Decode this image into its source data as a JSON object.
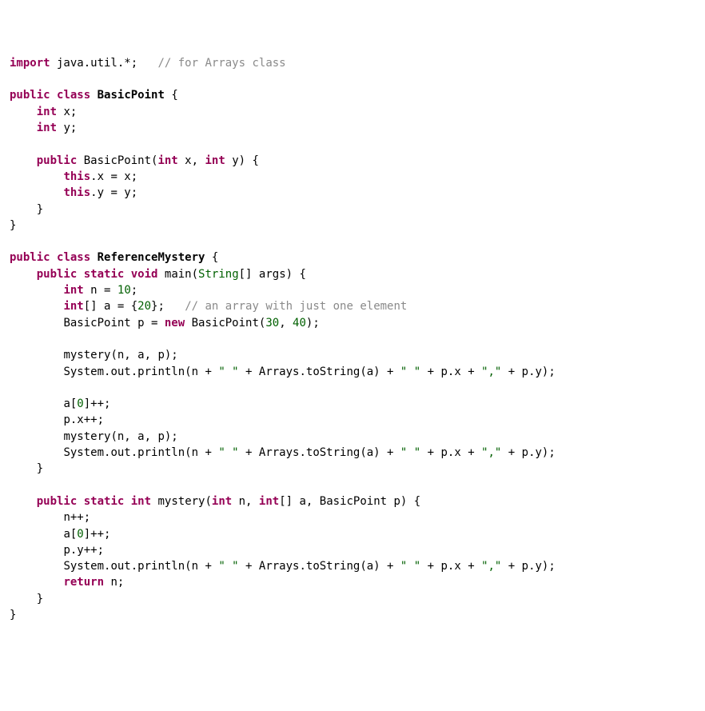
{
  "lines": [
    {
      "indent": 0,
      "tokens": [
        {
          "t": "import",
          "c": "kw"
        },
        {
          "t": " java.util."
        },
        {
          "t": "*",
          "c": "op"
        },
        {
          "t": ";"
        },
        {
          "t": "   "
        },
        {
          "t": "// for Arrays class",
          "c": "cmt"
        }
      ]
    },
    {
      "indent": 0,
      "tokens": []
    },
    {
      "indent": 0,
      "tokens": [
        {
          "t": "public",
          "c": "kw"
        },
        {
          "t": " "
        },
        {
          "t": "class",
          "c": "kw"
        },
        {
          "t": " "
        },
        {
          "t": "BasicPoint",
          "c": "cls"
        },
        {
          "t": " {"
        }
      ]
    },
    {
      "indent": 1,
      "tokens": [
        {
          "t": "int",
          "c": "kw"
        },
        {
          "t": " x;"
        }
      ]
    },
    {
      "indent": 1,
      "tokens": [
        {
          "t": "int",
          "c": "kw"
        },
        {
          "t": " y;"
        }
      ]
    },
    {
      "indent": 0,
      "tokens": []
    },
    {
      "indent": 1,
      "tokens": [
        {
          "t": "public",
          "c": "kw"
        },
        {
          "t": " BasicPoint("
        },
        {
          "t": "int",
          "c": "kw"
        },
        {
          "t": " x, "
        },
        {
          "t": "int",
          "c": "kw"
        },
        {
          "t": " y) {"
        }
      ]
    },
    {
      "indent": 2,
      "tokens": [
        {
          "t": "this",
          "c": "kw"
        },
        {
          "t": ".x = x;"
        }
      ]
    },
    {
      "indent": 2,
      "tokens": [
        {
          "t": "this",
          "c": "kw"
        },
        {
          "t": ".y = y;"
        }
      ]
    },
    {
      "indent": 1,
      "tokens": [
        {
          "t": "}"
        }
      ]
    },
    {
      "indent": 0,
      "tokens": [
        {
          "t": "}"
        }
      ]
    },
    {
      "indent": 0,
      "tokens": []
    },
    {
      "indent": 0,
      "tokens": [
        {
          "t": "public",
          "c": "kw"
        },
        {
          "t": " "
        },
        {
          "t": "class",
          "c": "kw"
        },
        {
          "t": " "
        },
        {
          "t": "ReferenceMystery",
          "c": "cls"
        },
        {
          "t": " {"
        }
      ]
    },
    {
      "indent": 1,
      "tokens": [
        {
          "t": "public",
          "c": "kw"
        },
        {
          "t": " "
        },
        {
          "t": "static",
          "c": "kw"
        },
        {
          "t": " "
        },
        {
          "t": "void",
          "c": "kw"
        },
        {
          "t": " main("
        },
        {
          "t": "String",
          "c": "typ"
        },
        {
          "t": "[] args) {"
        }
      ]
    },
    {
      "indent": 2,
      "tokens": [
        {
          "t": "int",
          "c": "kw"
        },
        {
          "t": " n = "
        },
        {
          "t": "10",
          "c": "num"
        },
        {
          "t": ";"
        }
      ]
    },
    {
      "indent": 2,
      "tokens": [
        {
          "t": "int",
          "c": "kw"
        },
        {
          "t": "[] a = {"
        },
        {
          "t": "20",
          "c": "num"
        },
        {
          "t": "};   "
        },
        {
          "t": "// an array with just one element",
          "c": "cmt"
        }
      ]
    },
    {
      "indent": 2,
      "tokens": [
        {
          "t": "BasicPoint p = "
        },
        {
          "t": "new",
          "c": "kw"
        },
        {
          "t": " BasicPoint("
        },
        {
          "t": "30",
          "c": "num"
        },
        {
          "t": ", "
        },
        {
          "t": "40",
          "c": "num"
        },
        {
          "t": ");"
        }
      ]
    },
    {
      "indent": 0,
      "tokens": []
    },
    {
      "indent": 2,
      "tokens": [
        {
          "t": "mystery(n, a, p);"
        }
      ]
    },
    {
      "indent": 2,
      "tokens": [
        {
          "t": "System.out.println(n + "
        },
        {
          "t": "\" \"",
          "c": "str"
        },
        {
          "t": " + Arrays.toString(a) + "
        },
        {
          "t": "\" \"",
          "c": "str"
        },
        {
          "t": " + p.x + "
        },
        {
          "t": "\",\"",
          "c": "str"
        },
        {
          "t": " + p.y);"
        }
      ]
    },
    {
      "indent": 0,
      "tokens": []
    },
    {
      "indent": 2,
      "tokens": [
        {
          "t": "a["
        },
        {
          "t": "0",
          "c": "num"
        },
        {
          "t": "]++;"
        }
      ]
    },
    {
      "indent": 2,
      "tokens": [
        {
          "t": "p.x++;"
        }
      ]
    },
    {
      "indent": 2,
      "tokens": [
        {
          "t": "mystery(n, a, p);"
        }
      ]
    },
    {
      "indent": 2,
      "tokens": [
        {
          "t": "System.out.println(n + "
        },
        {
          "t": "\" \"",
          "c": "str"
        },
        {
          "t": " + Arrays.toString(a) + "
        },
        {
          "t": "\" \"",
          "c": "str"
        },
        {
          "t": " + p.x + "
        },
        {
          "t": "\",\"",
          "c": "str"
        },
        {
          "t": " + p.y);"
        }
      ]
    },
    {
      "indent": 1,
      "tokens": [
        {
          "t": "}"
        }
      ]
    },
    {
      "indent": 0,
      "tokens": []
    },
    {
      "indent": 1,
      "tokens": [
        {
          "t": "public",
          "c": "kw"
        },
        {
          "t": " "
        },
        {
          "t": "static",
          "c": "kw"
        },
        {
          "t": " "
        },
        {
          "t": "int",
          "c": "kw"
        },
        {
          "t": " mystery("
        },
        {
          "t": "int",
          "c": "kw"
        },
        {
          "t": " n, "
        },
        {
          "t": "int",
          "c": "kw"
        },
        {
          "t": "[] a, BasicPoint p) {"
        }
      ]
    },
    {
      "indent": 2,
      "tokens": [
        {
          "t": "n++;"
        }
      ]
    },
    {
      "indent": 2,
      "tokens": [
        {
          "t": "a["
        },
        {
          "t": "0",
          "c": "num"
        },
        {
          "t": "]++;"
        }
      ]
    },
    {
      "indent": 2,
      "tokens": [
        {
          "t": "p.y++;"
        }
      ]
    },
    {
      "indent": 2,
      "tokens": [
        {
          "t": "System.out.println(n + "
        },
        {
          "t": "\" \"",
          "c": "str"
        },
        {
          "t": " + Arrays.toString(a) + "
        },
        {
          "t": "\" \"",
          "c": "str"
        },
        {
          "t": " + p.x + "
        },
        {
          "t": "\",\"",
          "c": "str"
        },
        {
          "t": " + p.y);"
        }
      ]
    },
    {
      "indent": 2,
      "tokens": [
        {
          "t": "return",
          "c": "kw"
        },
        {
          "t": " n;"
        }
      ]
    },
    {
      "indent": 1,
      "tokens": [
        {
          "t": "}"
        }
      ]
    },
    {
      "indent": 0,
      "tokens": [
        {
          "t": "}"
        }
      ]
    }
  ],
  "indent_unit": "    "
}
